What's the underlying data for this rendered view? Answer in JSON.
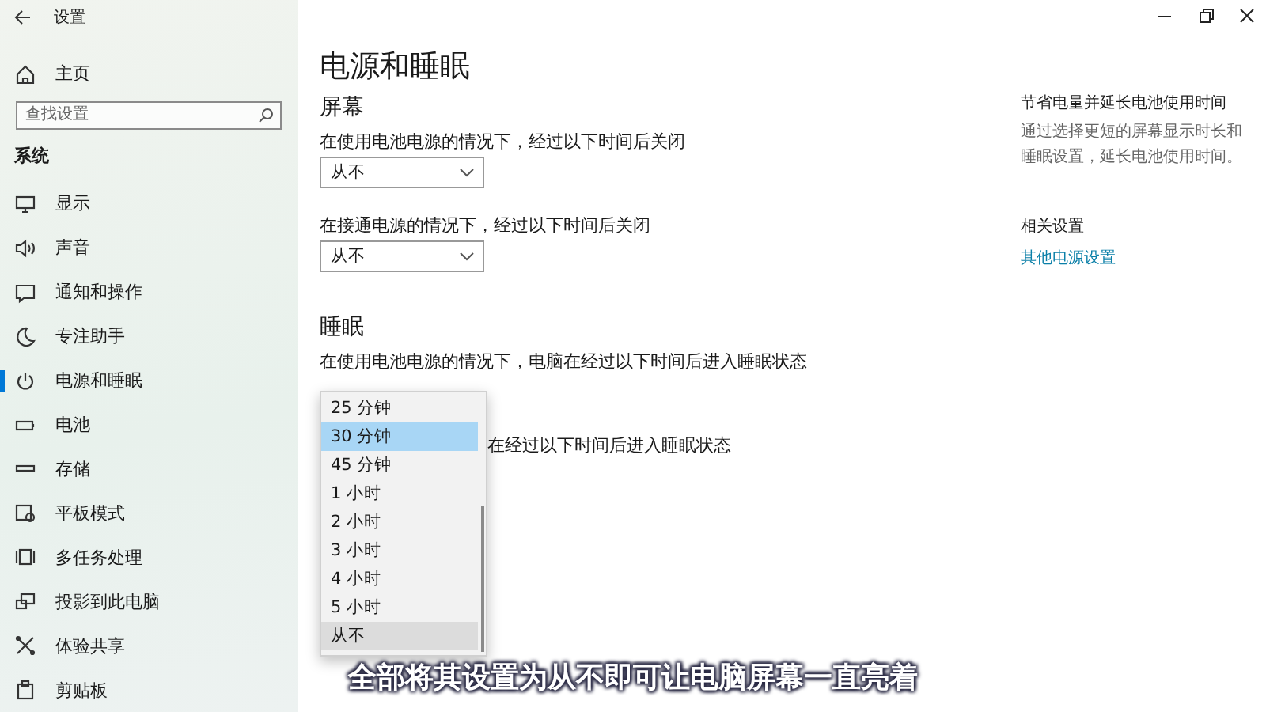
{
  "window": {
    "title": "设置"
  },
  "sidebar": {
    "home": "主页",
    "search": {
      "placeholder": "查找设置"
    },
    "section": "系统",
    "items": [
      {
        "label": "显示",
        "selected": false
      },
      {
        "label": "声音",
        "selected": false
      },
      {
        "label": "通知和操作",
        "selected": false
      },
      {
        "label": "专注助手",
        "selected": false
      },
      {
        "label": "电源和睡眠",
        "selected": true
      },
      {
        "label": "电池",
        "selected": false
      },
      {
        "label": "存储",
        "selected": false
      },
      {
        "label": "平板模式",
        "selected": false
      },
      {
        "label": "多任务处理",
        "selected": false
      },
      {
        "label": "投影到此电脑",
        "selected": false
      },
      {
        "label": "体验共享",
        "selected": false
      },
      {
        "label": "剪贴板",
        "selected": false
      }
    ]
  },
  "main": {
    "title": "电源和睡眠",
    "sections": [
      {
        "heading": "屏幕",
        "settings": [
          {
            "label": "在使用电池电源的情况下，经过以下时间后关闭",
            "value": "从不"
          },
          {
            "label": "在接通电源的情况下，经过以下时间后关闭",
            "value": "从不"
          }
        ]
      },
      {
        "heading": "睡眠",
        "settings": [
          {
            "label": "在使用电池电源的情况下，电脑在经过以下时间后进入睡眠状态"
          },
          {
            "label": "在经过以下时间后进入睡眠状态"
          }
        ]
      }
    ]
  },
  "dropdown_menu": {
    "options": [
      {
        "label": "25 分钟",
        "selected": false,
        "hovered": false
      },
      {
        "label": "30 分钟",
        "selected": true,
        "hovered": false
      },
      {
        "label": "45 分钟",
        "selected": false,
        "hovered": false
      },
      {
        "label": "1 小时",
        "selected": false,
        "hovered": false
      },
      {
        "label": "2 小时",
        "selected": false,
        "hovered": false
      },
      {
        "label": "3 小时",
        "selected": false,
        "hovered": false
      },
      {
        "label": "4 小时",
        "selected": false,
        "hovered": false
      },
      {
        "label": "5 小时",
        "selected": false,
        "hovered": false
      },
      {
        "label": "从不",
        "selected": false,
        "hovered": true
      }
    ]
  },
  "aside": {
    "heading": "节省电量并延长电池使用时间",
    "text": "通过选择更短的屏幕显示时长和睡眠设置，延长电池使用时间。",
    "related_heading": "相关设置",
    "link": "其他电源设置"
  },
  "caption": "全部将其设置为从不即可让电脑屏幕一直亮着"
}
